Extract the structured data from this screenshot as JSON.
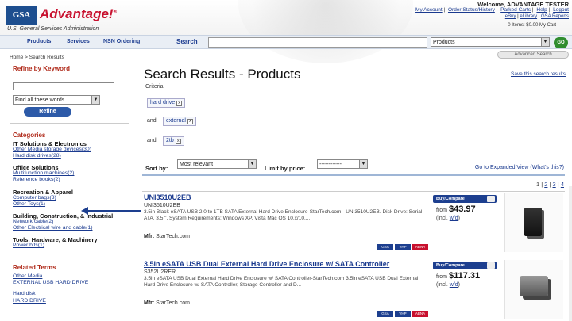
{
  "header": {
    "logo_gsa": "GSA",
    "logo_advantage": "Advantage!",
    "logo_tm": "®",
    "subtitle": "U.S. General Services Administration",
    "welcome": "Welcome, ADVANTAGE TESTER",
    "top_links": [
      "My Account",
      "Order Status/History",
      "Parked Carts",
      "Help",
      "Logout"
    ],
    "sub_links": [
      "eBuy",
      "eLibrary",
      "GSA Reports"
    ],
    "cart_summary": "0 Items: $0.00  My Cart"
  },
  "nav": {
    "items": [
      "Products",
      "Services",
      "NSN Ordering"
    ],
    "search_label": "Search",
    "search_value": "",
    "search_scope": "Products",
    "go_label": "GO",
    "advanced_search": "Advanced Search"
  },
  "breadcrumb": "Home > Search Results",
  "sidebar": {
    "refine_heading": "Refine by Keyword",
    "keyword_value": "",
    "match_mode": "Find all these words",
    "refine_button": "Refine",
    "categories_heading": "Categories",
    "categories": [
      {
        "title": "IT Solutions & Electronics",
        "links": [
          "Other Media storage devices(30)",
          "Hard disk drives(28)"
        ]
      },
      {
        "title": "Office Solutions",
        "links": [
          "Multifunction machines(2)",
          "Reference books(2)"
        ]
      },
      {
        "title": "Recreation & Apparel",
        "links": [
          "Computer bags(3)",
          "Other Toys(1)"
        ]
      },
      {
        "title": "Building, Construction, & Industrial",
        "links": [
          "Network cable(2)",
          "Other Electrical wire and cable(1)"
        ]
      },
      {
        "title": "Tools, Hardware, & Machinery",
        "links": [
          "Power bits(1)"
        ]
      }
    ],
    "related_heading": "Related Terms",
    "related": [
      "Other Media",
      "EXTERNAL USB HARD DRIVE",
      "Hard disk",
      "HARD DRIVE"
    ]
  },
  "main": {
    "title": "Search Results - Products",
    "save_link": "Save this search results",
    "criteria_label": "Criteria:",
    "criteria": [
      {
        "op": "",
        "term": "hard drive"
      },
      {
        "op": "and",
        "term": "external"
      },
      {
        "op": "and",
        "term": "2tb"
      }
    ],
    "sort_label": "Sort by:",
    "sort_value": "Most relevant",
    "price_label": "Limit by price:",
    "price_value": "------------",
    "expanded_link": "Go to Expanded View",
    "whats_this": "(What's this?)",
    "pager": [
      "1",
      "2",
      "3",
      "4"
    ],
    "results": [
      {
        "title": "UNI3510U2EB",
        "sku": "UNI3510U2EB",
        "desc": "3.5in Black eSATA USB 2.0 to 1TB SATA External Hard Drive Enclosure-StarTech.com - UNI3510U2EB. Disk Drive: Serial ATA, 3.5 \". System Requirements: Windows XP, Vista Mac OS 10.x/10....",
        "mfr_label": "Mfr:",
        "mfr": "StarTech.com",
        "buy_label": "Buy/Compare",
        "price_from": "from",
        "price": "$43.97",
        "incl": "(incl.",
        "incl_link": "w/d"
      },
      {
        "title": "3.5in eSATA USB Dual External Hard Drive Enclosure w/ SATA Controller",
        "sku": "S352U2RER",
        "desc": "3.5in eSATA USB Dual External Hard Drive Enclosure w/ SATA Controller-StarTech.com 3.5in eSATA USB Dual External Hard Drive Enclosure w/ SATA Controller, Storage Controller and D...",
        "mfr_label": "Mfr:",
        "mfr": "StarTech.com",
        "buy_label": "Buy/Compare",
        "price_from": "from",
        "price": "$117.31",
        "incl": "(incl.",
        "incl_link": "w/d"
      }
    ],
    "badge_labels": [
      "GSA",
      "VHP",
      "ABNA"
    ]
  },
  "colors": {
    "brand_blue": "#1d3f8f",
    "brand_red": "#c8102e",
    "link_blue": "#1a3a8f"
  }
}
